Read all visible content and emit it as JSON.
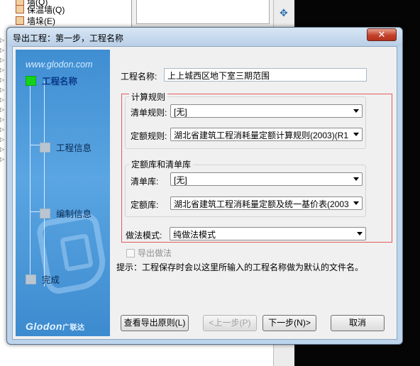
{
  "background": {
    "tree_items": [
      "墙(Q)",
      "保温墙(Q)",
      "墙垛(E)"
    ],
    "move_icon": "move-icon"
  },
  "dialog": {
    "title": "导出工程：第一步，工程名称",
    "close_icon": "close-icon",
    "website": "www.glodon.com",
    "steps": [
      {
        "label": "工程名称",
        "active": true
      },
      {
        "label": "工程信息",
        "active": false
      },
      {
        "label": "编制信息",
        "active": false
      },
      {
        "label": "完成",
        "active": false
      }
    ],
    "brand": "Glodon",
    "brand_cn": "广联达",
    "project_name_label": "工程名称:",
    "project_name_value": "上上城西区地下室三期范围",
    "calc_rules": {
      "title": "计算规则",
      "bill_rule_label": "清单规则:",
      "bill_rule_value": "[无]",
      "quota_rule_label": "定额规则:",
      "quota_rule_value": "湖北省建筑工程消耗量定额计算规则(2003)(R1"
    },
    "libraries": {
      "title": "定额库和清单库",
      "bill_lib_label": "清单库:",
      "bill_lib_value": "[无]",
      "quota_lib_label": "定额库:",
      "quota_lib_value": "湖北省建筑工程消耗量定额及统一基价表(2003"
    },
    "method_mode_label": "做法模式:",
    "method_mode_value": "纯做法模式",
    "export_method_label": "导出做法",
    "hint": "提示：工程保存时会以这里所输入的工程名称做为默认的文件名。",
    "buttons": {
      "view_rules": "查看导出原则(L)",
      "prev": "<上一步(P)",
      "next": "下一步(N)>",
      "cancel": "取消"
    }
  }
}
